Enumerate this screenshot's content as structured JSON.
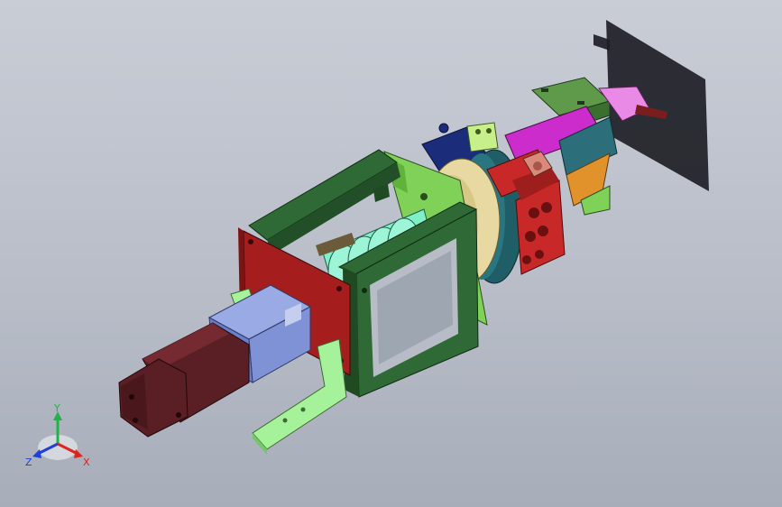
{
  "triad": {
    "x_label": "X",
    "y_label": "Y",
    "z_label": "Z",
    "colors": {
      "x": "#e0231c",
      "y": "#26b04a",
      "z": "#1f3fd6"
    }
  },
  "model": {
    "palette": {
      "motor": "#5a1f24",
      "gearbox": "#7f92d6",
      "front_plate": "#a51d1d",
      "frame": "#2f6a36",
      "frame_light": "#7fd257",
      "bracket": "#a6f29a",
      "screw": "#7ff0c7",
      "bearing": "#e8d9a2",
      "ring": "#1f5e66",
      "slide_red": "#d32b2b",
      "magenta": "#d12bd1",
      "orange": "#e0902a",
      "violet": "#e37ff0",
      "navy": "#1a2c7a",
      "shadow": "#24262c"
    }
  }
}
